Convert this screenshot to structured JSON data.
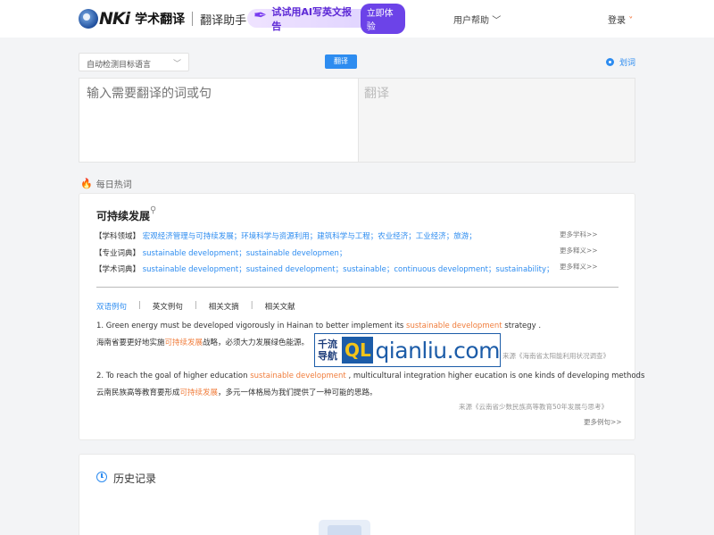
{
  "header": {
    "logo_brand": "NKi",
    "logo_title": "学术翻译",
    "logo_sub": "翻译助手",
    "ai_banner_text": "试试用AI写英文报告",
    "ai_banner_button": "立即体验",
    "help": "用户帮助",
    "login": "登录"
  },
  "translator": {
    "lang_select": "自动检测目标语言",
    "translate_button": "翻译",
    "huaci": "划词",
    "input_placeholder": "输入需要翻译的词或句",
    "output_label": "翻译"
  },
  "hot": {
    "label": "每日热词",
    "term": "可持续发展",
    "rows": [
      {
        "label": "【学科领域】",
        "values": "宏观经济管理与可持续发展；环境科学与资源利用；建筑科学与工程；农业经济；工业经济；旅游；",
        "more": "更多学科>>"
      },
      {
        "label": "【专业词典】",
        "values": "sustainable development；sustainable developmen；",
        "more": "更多释义>>"
      },
      {
        "label": "【学术词典】",
        "values": "sustainable development；sustained development；sustainable；continuous development；sustainability；",
        "more": "更多释义>>"
      }
    ],
    "tabs": [
      "双语例句",
      "英文例句",
      "相关文摘",
      "相关文献"
    ],
    "examples": [
      {
        "en_pre": "1. Green energy must be developed vigorously in Hainan to better implement its ",
        "en_hl": "sustainable development",
        "en_post": " strategy .",
        "cn_pre": "海南省要更好地实施",
        "cn_hl": "可持续发展",
        "cn_post": "战略，必须大力发展绿色能源。",
        "source": "来源《海南省太阳能利用状况调查》"
      },
      {
        "en_pre": "2. To reach the goal of higher education ",
        "en_hl": "sustainable development",
        "en_post": " , multicultural integration higher eucation is one kinds of developing methods",
        "cn_pre": "云南民族高等教育要形成",
        "cn_hl": "可持续发展",
        "cn_post": "，多元一体格局为我们提供了一种可能的思路。",
        "source": "来源《云南省少数民族高等教育50年发展与思考》"
      }
    ],
    "more_examples": "更多例句>>"
  },
  "watermark": {
    "cn_line1": "千流",
    "cn_line2": "导航",
    "ql": "QL",
    "site": "qianliu.com"
  },
  "history": {
    "title": "历史记录"
  },
  "colors": {
    "accent": "#2d8cf0",
    "highlight": "#f07d3c",
    "ai_purple": "#6c43e8"
  }
}
